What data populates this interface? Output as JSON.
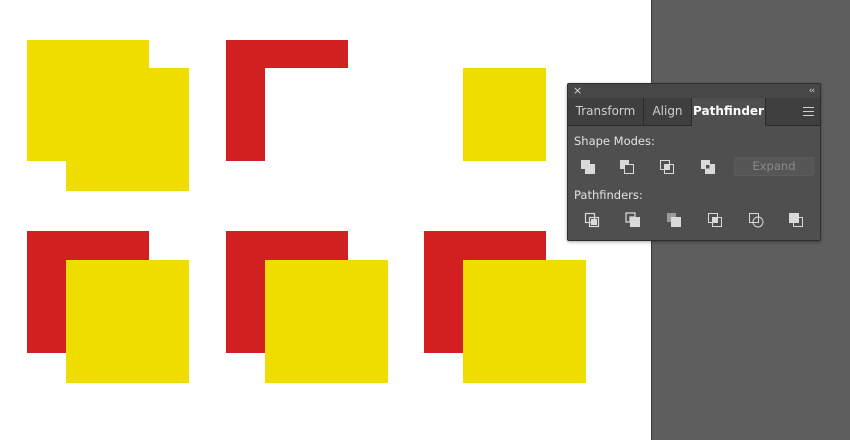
{
  "panel": {
    "close_glyph": "×",
    "collapse_glyph": "‹‹",
    "tabs": [
      {
        "label": "Transform",
        "active": false
      },
      {
        "label": "Align",
        "active": false
      },
      {
        "label": "Pathfinder",
        "active": true
      }
    ],
    "shape_modes": {
      "label": "Shape Modes:",
      "buttons": [
        "unite-icon",
        "minus-front-icon",
        "intersect-icon",
        "exclude-icon"
      ],
      "expand_label": "Expand",
      "expand_enabled": false
    },
    "pathfinders": {
      "label": "Pathfinders:",
      "buttons": [
        "divide-icon",
        "trim-icon",
        "merge-icon",
        "crop-icon",
        "outline-icon",
        "minus-back-icon"
      ]
    }
  },
  "colors": {
    "yellow": "#efdd00",
    "red": "#d21f20",
    "panel_bg": "#4f4f4f",
    "pasteboard": "#5e5e5e"
  }
}
